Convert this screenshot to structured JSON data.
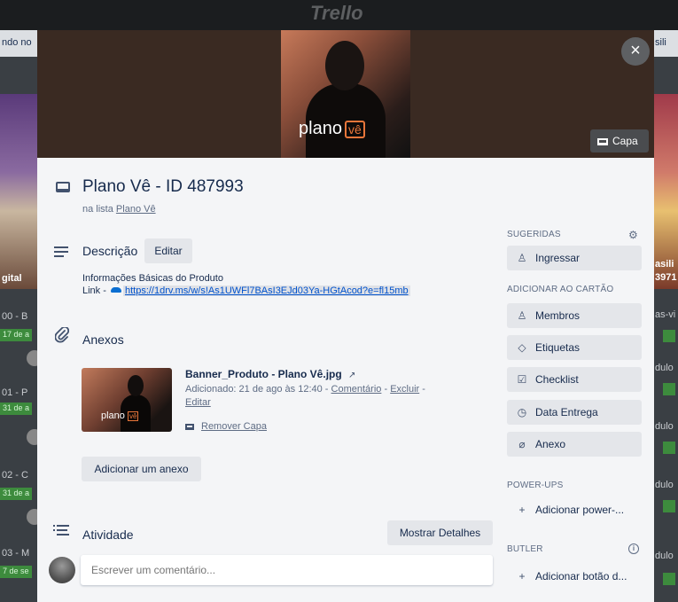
{
  "board": {
    "logo": "Trello",
    "left_fragments": [
      "ndo no",
      "gital",
      "00 - B",
      "17 de a",
      "01 - P",
      "31 de a",
      "02 - C",
      "31 de a",
      "03 - M",
      "7 de se"
    ],
    "right_fragments": [
      "sili",
      "asili",
      "3971",
      "as-vi",
      "dulo",
      "dulo",
      "dulo",
      "dulo"
    ]
  },
  "cover": {
    "logo_text": "plano",
    "logo_mark": "vê",
    "capa_label": "Capa",
    "close_symbol": "×"
  },
  "card": {
    "title": "Plano Vê - ID 487993",
    "in_list_prefix": "na lista",
    "list_name": "Plano Vê"
  },
  "description": {
    "title": "Descrição",
    "edit_label": "Editar",
    "line1": "Informações Básicas do Produto",
    "link_prefix": "Link -",
    "link_url": "https://1drv.ms/w/s!As1UWFl7BAsI3EJd03Ya-HGtAcod?e=fl15mb"
  },
  "attachments": {
    "title": "Anexos",
    "file_name": "Banner_Produto - Plano Vê.jpg",
    "external_symbol": "↗",
    "added_text": "Adicionado: 21 de ago às 12:40 -",
    "comment_link": "Comentário",
    "separator": "-",
    "delete_link": "Excluir",
    "edit_link": "Editar",
    "remove_cover_label": "Remover Capa",
    "add_attachment_label": "Adicionar um anexo",
    "thumb_logo": "plano",
    "thumb_mark": "vê"
  },
  "activity": {
    "title": "Atividade",
    "show_details_label": "Mostrar Detalhes",
    "comment_placeholder": "Escrever um comentário..."
  },
  "sidebar": {
    "suggested_label": "SUGERIDAS",
    "join_label": "Ingressar",
    "add_to_card_label": "ADICIONAR AO CARTÃO",
    "items": [
      {
        "label": "Membros",
        "icon": "person-icon"
      },
      {
        "label": "Etiquetas",
        "icon": "tag-icon"
      },
      {
        "label": "Checklist",
        "icon": "checklist-icon"
      },
      {
        "label": "Data Entrega",
        "icon": "clock-icon"
      },
      {
        "label": "Anexo",
        "icon": "paperclip-icon"
      }
    ],
    "powerups_label": "POWER-UPS",
    "add_powerup_label": "Adicionar power-...",
    "butler_label": "BUTLER",
    "add_button_label": "Adicionar botão d..."
  },
  "colors": {
    "modal_bg": "#f4f5f7",
    "button_bg": "#e4e6ea",
    "link_blue": "#0052cc",
    "brand_orange": "#e8763a"
  }
}
